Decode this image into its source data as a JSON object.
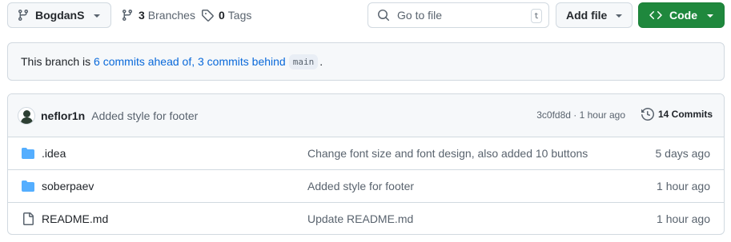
{
  "toolbar": {
    "branch": "BogdanS",
    "branches_count": "3",
    "branches_label": "Branches",
    "tags_count": "0",
    "tags_label": "Tags",
    "search_placeholder": "Go to file",
    "search_shortcut": "t",
    "add_file_label": "Add file",
    "code_label": "Code"
  },
  "compare": {
    "prefix": "This branch is ",
    "ahead": "6 commits ahead of,",
    "behind": "3 commits behind",
    "base": "main",
    "suffix": "."
  },
  "latest_commit": {
    "author": "neflor1n",
    "message": "Added style for footer",
    "meta": "3c0fd8d · 1 hour ago",
    "count_label": "14 Commits"
  },
  "files": [
    {
      "type": "folder",
      "name": ".idea",
      "message": "Change font size and font design, also added 10 buttons",
      "age": "5 days ago"
    },
    {
      "type": "folder",
      "name": "soberpaev",
      "message": "Added style for footer",
      "age": "1 hour ago"
    },
    {
      "type": "file",
      "name": "README.md",
      "message": "Update README.md",
      "age": "1 hour ago"
    }
  ],
  "icons": {
    "branch": "git-branch-icon",
    "tag": "tag-icon",
    "search": "search-icon",
    "code": "code-icon",
    "history": "history-icon",
    "folder": "folder-icon",
    "file": "file-icon"
  },
  "colors": {
    "accent_green": "#1f883d",
    "link_blue": "#0969da",
    "folder_blue": "#54aeff",
    "muted": "#59636e"
  }
}
